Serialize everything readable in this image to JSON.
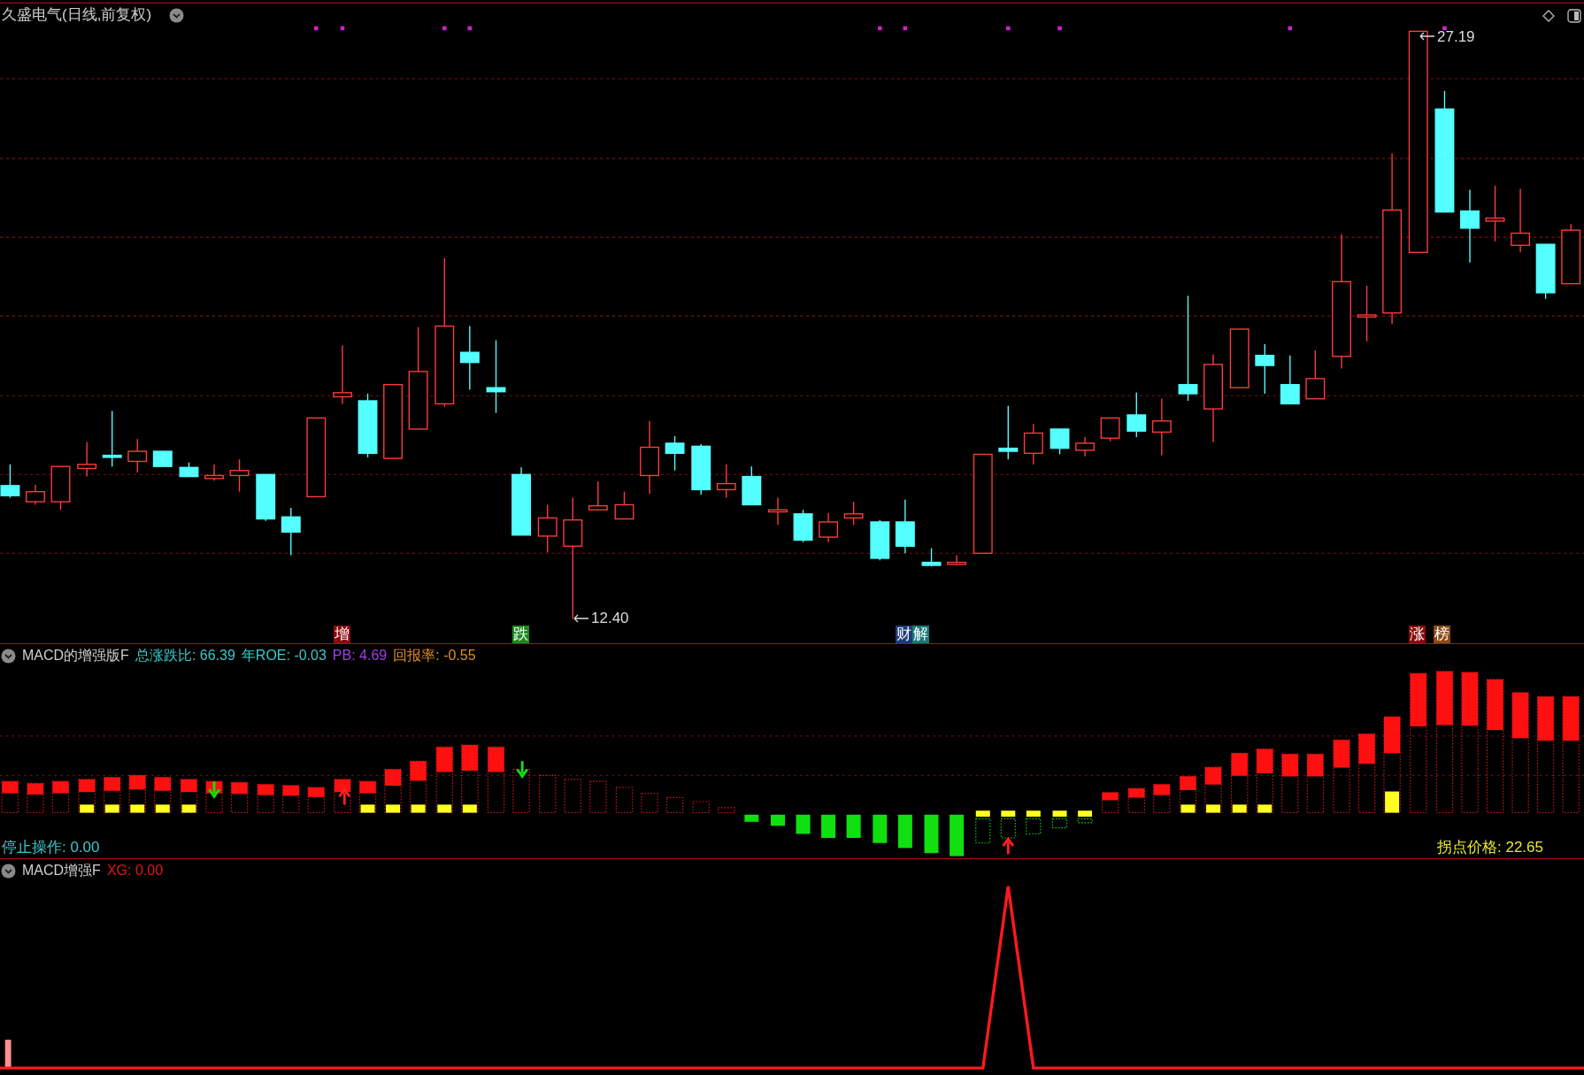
{
  "header": {
    "title": "久盛电气(日线,前复权)"
  },
  "price_chart": {
    "high_label": "27.19",
    "low_label": "12.40",
    "event_tags": [
      {
        "text": "增",
        "color": "#8b0a0a"
      },
      {
        "text": "跌",
        "color": "#1e8c1e"
      },
      {
        "text": "财",
        "color": "#1e3c78"
      },
      {
        "text": "解",
        "color": "#1a7878"
      },
      {
        "text": "涨",
        "color": "#8b0a0a"
      },
      {
        "text": "榜",
        "color": "#8a4a14"
      }
    ]
  },
  "macd_panel": {
    "title": "MACD的增强版F",
    "readouts": [
      {
        "text": "总涨跌比: 66.39",
        "color": "#3cc8c8"
      },
      {
        "text": "年ROE: -0.03",
        "color": "#3cc8c8"
      },
      {
        "text": "PB: 4.69",
        "color": "#a040e0"
      },
      {
        "text": "回报率: -0.55",
        "color": "#e09020"
      }
    ],
    "stop_label": "停止操作: 0.00",
    "pivot_label": "拐点价格: 22.65"
  },
  "xg_panel": {
    "title": "MACD增强F",
    "readout": "XG: 0.00"
  }
}
